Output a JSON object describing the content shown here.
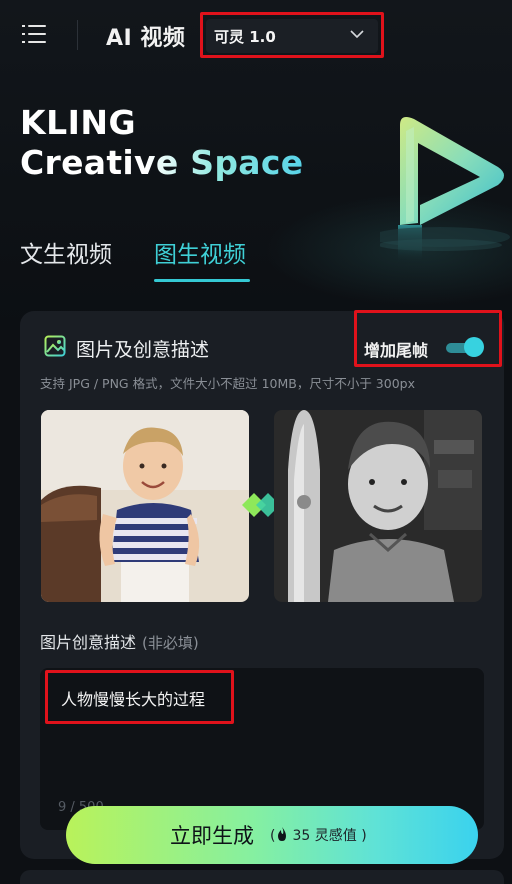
{
  "header": {
    "title": "AI 视频",
    "model_select": {
      "value": "可灵 1.0"
    }
  },
  "hero": {
    "line1": "KLING",
    "line2": "Creative Space"
  },
  "tabs": [
    {
      "label": "文生视频",
      "active": false
    },
    {
      "label": "图生视频",
      "active": true
    }
  ],
  "card": {
    "section_title": "图片及创意描述",
    "add_tail_frame": {
      "label": "增加尾帧",
      "enabled": true
    },
    "hint": "支持 JPG / PNG 格式，文件大小不超过 10MB，尺寸不小于 300px",
    "description": {
      "label": "图片创意描述",
      "optional": "(非必填)",
      "value": "人物慢慢长大的过程",
      "char_count": "9 / 500"
    }
  },
  "generate": {
    "label": "立即生成",
    "cost": "35 灵感值",
    "paren_open": "(",
    "paren_close": ")"
  },
  "colors": {
    "accent": "#3fd0d6",
    "highlight_box": "#e0121b",
    "background": "#0d1014",
    "card": "#1a1e24"
  }
}
